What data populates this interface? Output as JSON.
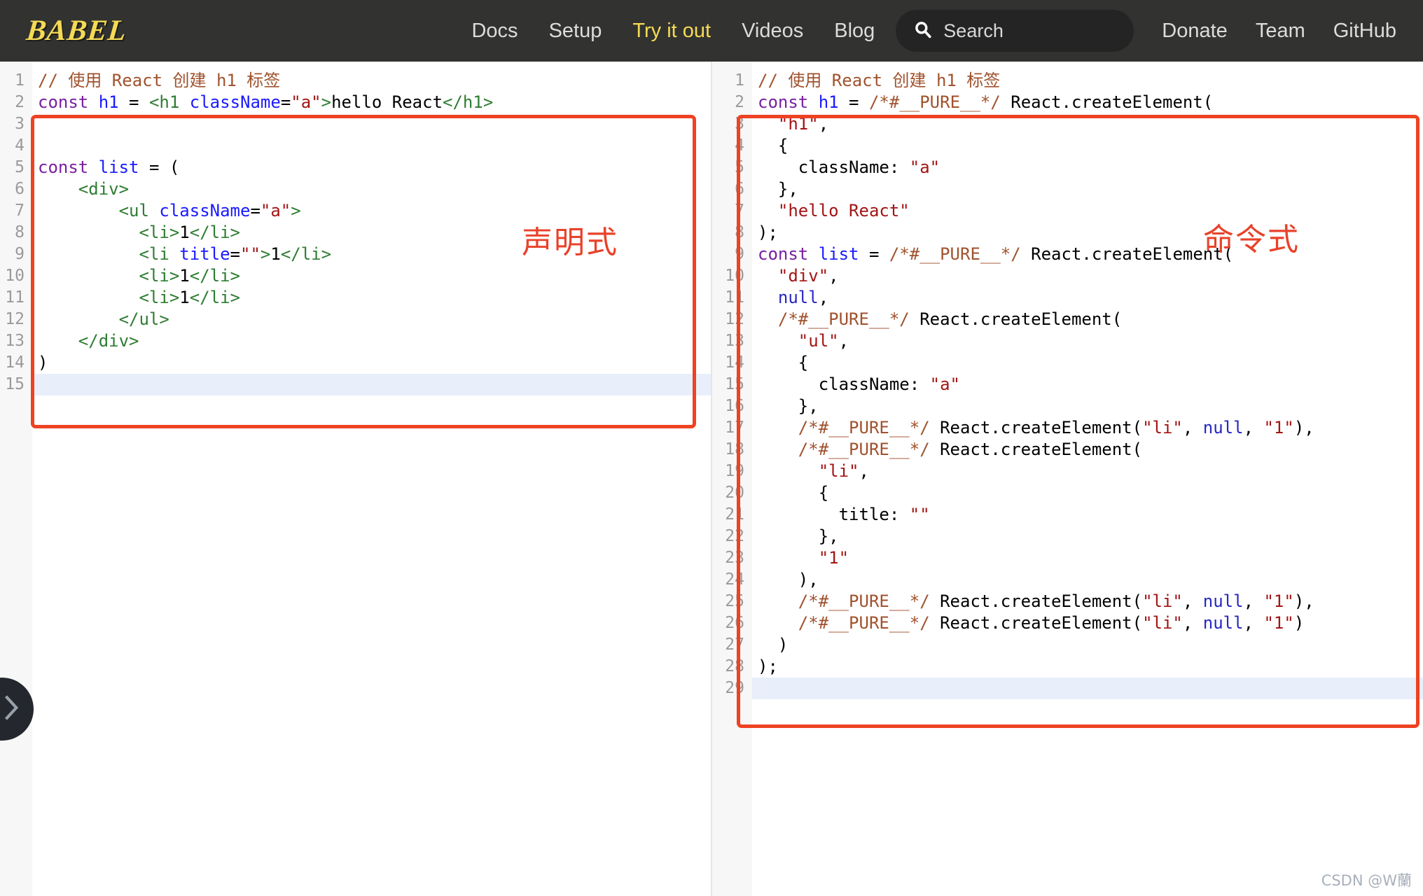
{
  "navbar": {
    "brand": "BABEL",
    "links": [
      {
        "label": "Docs",
        "active": false
      },
      {
        "label": "Setup",
        "active": false
      },
      {
        "label": "Try it out",
        "active": true
      },
      {
        "label": "Videos",
        "active": false
      },
      {
        "label": "Blog",
        "active": false
      }
    ],
    "search": {
      "label": "Search",
      "icon": "search-icon"
    },
    "right_links": [
      {
        "label": "Donate"
      },
      {
        "label": "Team"
      },
      {
        "label": "GitHub"
      }
    ]
  },
  "annotations": {
    "left": "声明式",
    "right": "命令式",
    "color": "#e8422a"
  },
  "watermark": "CSDN @W蘭",
  "drawer_toggle": {
    "icon": "chevron-right-icon"
  },
  "left_pane": {
    "name": "jsx-source-editor",
    "active_line": 15,
    "lines": [
      {
        "n": 1,
        "tokens": [
          {
            "t": "// 使用 React 创建 h1 标签",
            "c": "t-com"
          }
        ]
      },
      {
        "n": 2,
        "tokens": [
          {
            "t": "const ",
            "c": "t-kw"
          },
          {
            "t": "h1",
            "c": "t-var"
          },
          {
            "t": " = ",
            "c": "t-pl"
          },
          {
            "t": "<h1 ",
            "c": "t-tag"
          },
          {
            "t": "className",
            "c": "t-attr"
          },
          {
            "t": "=",
            "c": "t-pl"
          },
          {
            "t": "\"a\"",
            "c": "t-str"
          },
          {
            "t": ">",
            "c": "t-tag"
          },
          {
            "t": "hello React",
            "c": "t-pl"
          },
          {
            "t": "</h1>",
            "c": "t-tag"
          }
        ]
      },
      {
        "n": 3,
        "tokens": []
      },
      {
        "n": 4,
        "tokens": []
      },
      {
        "n": 5,
        "tokens": [
          {
            "t": "const ",
            "c": "t-kw"
          },
          {
            "t": "list",
            "c": "t-var"
          },
          {
            "t": " = (",
            "c": "t-pl"
          }
        ]
      },
      {
        "n": 6,
        "tokens": [
          {
            "t": "    <div>",
            "c": "t-tag"
          }
        ]
      },
      {
        "n": 7,
        "tokens": [
          {
            "t": "        <ul ",
            "c": "t-tag"
          },
          {
            "t": "className",
            "c": "t-attr"
          },
          {
            "t": "=",
            "c": "t-pl"
          },
          {
            "t": "\"a\"",
            "c": "t-str"
          },
          {
            "t": ">",
            "c": "t-tag"
          }
        ]
      },
      {
        "n": 8,
        "tokens": [
          {
            "t": "          <li>",
            "c": "t-tag"
          },
          {
            "t": "1",
            "c": "t-pl"
          },
          {
            "t": "</li>",
            "c": "t-tag"
          }
        ]
      },
      {
        "n": 9,
        "tokens": [
          {
            "t": "          <li ",
            "c": "t-tag"
          },
          {
            "t": "title",
            "c": "t-attr"
          },
          {
            "t": "=",
            "c": "t-pl"
          },
          {
            "t": "\"\"",
            "c": "t-str"
          },
          {
            "t": ">",
            "c": "t-tag"
          },
          {
            "t": "1",
            "c": "t-pl"
          },
          {
            "t": "</li>",
            "c": "t-tag"
          }
        ]
      },
      {
        "n": 10,
        "tokens": [
          {
            "t": "          <li>",
            "c": "t-tag"
          },
          {
            "t": "1",
            "c": "t-pl"
          },
          {
            "t": "</li>",
            "c": "t-tag"
          }
        ]
      },
      {
        "n": 11,
        "tokens": [
          {
            "t": "          <li>",
            "c": "t-tag"
          },
          {
            "t": "1",
            "c": "t-pl"
          },
          {
            "t": "</li>",
            "c": "t-tag"
          }
        ]
      },
      {
        "n": 12,
        "tokens": [
          {
            "t": "        </ul>",
            "c": "t-tag"
          }
        ]
      },
      {
        "n": 13,
        "tokens": [
          {
            "t": "    </div>",
            "c": "t-tag"
          }
        ]
      },
      {
        "n": 14,
        "tokens": [
          {
            "t": ")",
            "c": "t-pl"
          }
        ]
      },
      {
        "n": 15,
        "tokens": []
      }
    ]
  },
  "right_pane": {
    "name": "compiled-output-editor",
    "active_line": 29,
    "lines": [
      {
        "n": 1,
        "tokens": [
          {
            "t": "// 使用 React 创建 h1 标签",
            "c": "t-com"
          }
        ]
      },
      {
        "n": 2,
        "tokens": [
          {
            "t": "const ",
            "c": "t-kw"
          },
          {
            "t": "h1",
            "c": "t-var"
          },
          {
            "t": " = ",
            "c": "t-pl"
          },
          {
            "t": "/*#__PURE__*/",
            "c": "t-com"
          },
          {
            "t": " React.createElement(",
            "c": "t-pl"
          }
        ]
      },
      {
        "n": 3,
        "tokens": [
          {
            "t": "  ",
            "c": "t-pl"
          },
          {
            "t": "\"h1\"",
            "c": "t-str"
          },
          {
            "t": ",",
            "c": "t-pl"
          }
        ]
      },
      {
        "n": 4,
        "tokens": [
          {
            "t": "  {",
            "c": "t-pl"
          }
        ]
      },
      {
        "n": 5,
        "tokens": [
          {
            "t": "    className: ",
            "c": "t-pl"
          },
          {
            "t": "\"a\"",
            "c": "t-str"
          }
        ]
      },
      {
        "n": 6,
        "tokens": [
          {
            "t": "  },",
            "c": "t-pl"
          }
        ]
      },
      {
        "n": 7,
        "tokens": [
          {
            "t": "  ",
            "c": "t-pl"
          },
          {
            "t": "\"hello React\"",
            "c": "t-str"
          }
        ]
      },
      {
        "n": 8,
        "tokens": [
          {
            "t": ");",
            "c": "t-pl"
          }
        ]
      },
      {
        "n": 9,
        "tokens": [
          {
            "t": "const ",
            "c": "t-kw"
          },
          {
            "t": "list",
            "c": "t-var"
          },
          {
            "t": " = ",
            "c": "t-pl"
          },
          {
            "t": "/*#__PURE__*/",
            "c": "t-com"
          },
          {
            "t": " React.createElement(",
            "c": "t-pl"
          }
        ]
      },
      {
        "n": 10,
        "tokens": [
          {
            "t": "  ",
            "c": "t-pl"
          },
          {
            "t": "\"div\"",
            "c": "t-str"
          },
          {
            "t": ",",
            "c": "t-pl"
          }
        ]
      },
      {
        "n": 11,
        "tokens": [
          {
            "t": "  ",
            "c": "t-pl"
          },
          {
            "t": "null",
            "c": "t-null"
          },
          {
            "t": ",",
            "c": "t-pl"
          }
        ]
      },
      {
        "n": 12,
        "tokens": [
          {
            "t": "  ",
            "c": "t-pl"
          },
          {
            "t": "/*#__PURE__*/",
            "c": "t-com"
          },
          {
            "t": " React.createElement(",
            "c": "t-pl"
          }
        ]
      },
      {
        "n": 13,
        "tokens": [
          {
            "t": "    ",
            "c": "t-pl"
          },
          {
            "t": "\"ul\"",
            "c": "t-str"
          },
          {
            "t": ",",
            "c": "t-pl"
          }
        ]
      },
      {
        "n": 14,
        "tokens": [
          {
            "t": "    {",
            "c": "t-pl"
          }
        ]
      },
      {
        "n": 15,
        "tokens": [
          {
            "t": "      className: ",
            "c": "t-pl"
          },
          {
            "t": "\"a\"",
            "c": "t-str"
          }
        ]
      },
      {
        "n": 16,
        "tokens": [
          {
            "t": "    },",
            "c": "t-pl"
          }
        ]
      },
      {
        "n": 17,
        "tokens": [
          {
            "t": "    ",
            "c": "t-pl"
          },
          {
            "t": "/*#__PURE__*/",
            "c": "t-com"
          },
          {
            "t": " React.createElement(",
            "c": "t-pl"
          },
          {
            "t": "\"li\"",
            "c": "t-str"
          },
          {
            "t": ", ",
            "c": "t-pl"
          },
          {
            "t": "null",
            "c": "t-null"
          },
          {
            "t": ", ",
            "c": "t-pl"
          },
          {
            "t": "\"1\"",
            "c": "t-str"
          },
          {
            "t": "),",
            "c": "t-pl"
          }
        ]
      },
      {
        "n": 18,
        "tokens": [
          {
            "t": "    ",
            "c": "t-pl"
          },
          {
            "t": "/*#__PURE__*/",
            "c": "t-com"
          },
          {
            "t": " React.createElement(",
            "c": "t-pl"
          }
        ]
      },
      {
        "n": 19,
        "tokens": [
          {
            "t": "      ",
            "c": "t-pl"
          },
          {
            "t": "\"li\"",
            "c": "t-str"
          },
          {
            "t": ",",
            "c": "t-pl"
          }
        ]
      },
      {
        "n": 20,
        "tokens": [
          {
            "t": "      {",
            "c": "t-pl"
          }
        ]
      },
      {
        "n": 21,
        "tokens": [
          {
            "t": "        title: ",
            "c": "t-pl"
          },
          {
            "t": "\"\"",
            "c": "t-str"
          }
        ]
      },
      {
        "n": 22,
        "tokens": [
          {
            "t": "      },",
            "c": "t-pl"
          }
        ]
      },
      {
        "n": 23,
        "tokens": [
          {
            "t": "      ",
            "c": "t-pl"
          },
          {
            "t": "\"1\"",
            "c": "t-str"
          }
        ]
      },
      {
        "n": 24,
        "tokens": [
          {
            "t": "    ),",
            "c": "t-pl"
          }
        ]
      },
      {
        "n": 25,
        "tokens": [
          {
            "t": "    ",
            "c": "t-pl"
          },
          {
            "t": "/*#__PURE__*/",
            "c": "t-com"
          },
          {
            "t": " React.createElement(",
            "c": "t-pl"
          },
          {
            "t": "\"li\"",
            "c": "t-str"
          },
          {
            "t": ", ",
            "c": "t-pl"
          },
          {
            "t": "null",
            "c": "t-null"
          },
          {
            "t": ", ",
            "c": "t-pl"
          },
          {
            "t": "\"1\"",
            "c": "t-str"
          },
          {
            "t": "),",
            "c": "t-pl"
          }
        ]
      },
      {
        "n": 26,
        "tokens": [
          {
            "t": "    ",
            "c": "t-pl"
          },
          {
            "t": "/*#__PURE__*/",
            "c": "t-com"
          },
          {
            "t": " React.createElement(",
            "c": "t-pl"
          },
          {
            "t": "\"li\"",
            "c": "t-str"
          },
          {
            "t": ", ",
            "c": "t-pl"
          },
          {
            "t": "null",
            "c": "t-null"
          },
          {
            "t": ", ",
            "c": "t-pl"
          },
          {
            "t": "\"1\"",
            "c": "t-str"
          },
          {
            "t": ")",
            "c": "t-pl"
          }
        ]
      },
      {
        "n": 27,
        "tokens": [
          {
            "t": "  )",
            "c": "t-pl"
          }
        ]
      },
      {
        "n": 28,
        "tokens": [
          {
            "t": ");",
            "c": "t-pl"
          }
        ]
      },
      {
        "n": 29,
        "tokens": []
      }
    ]
  }
}
